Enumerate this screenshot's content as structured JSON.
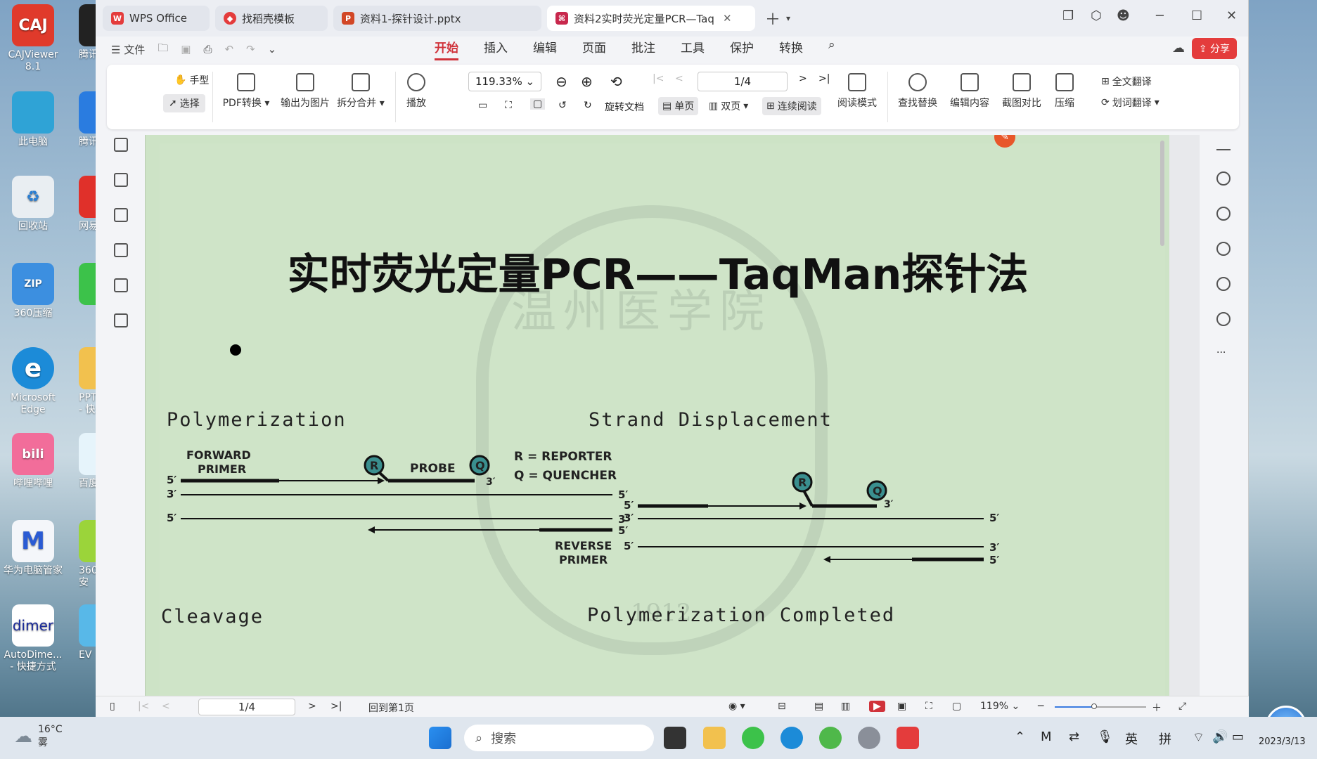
{
  "desktop": {
    "icons": [
      {
        "label": "CAJViewer 8.1",
        "color": "#e03a2b",
        "glyph": "CAJ"
      },
      {
        "label": "此电脑",
        "color": "#2fa3d6",
        "glyph": ""
      },
      {
        "label": "回收站",
        "color": "#e9eef2",
        "glyph": "♻"
      },
      {
        "label": "360压缩",
        "color": "#3c8fe0",
        "glyph": "ZIP"
      },
      {
        "label": "Microsoft Edge",
        "color": "#1c8bd8",
        "glyph": "e"
      },
      {
        "label": "哔哩哔哩",
        "color": "#f26d9a",
        "glyph": "bili"
      },
      {
        "label": "华为电脑管家",
        "color": "#f4f6fa",
        "glyph": "M"
      },
      {
        "label": "AutoDime... - 快捷方式",
        "color": "#ffffff",
        "glyph": "dimer"
      }
    ],
    "col2": [
      "腾讯",
      "腾讯",
      "网易",
      "",
      "PPT - 快",
      "百度",
      "360安",
      "EV"
    ]
  },
  "tabs": [
    {
      "label": "WPS Office",
      "icon": "wps-icon"
    },
    {
      "label": "找稻壳模板",
      "icon": "docer-icon"
    },
    {
      "label": "资料1-探针设计.pptx",
      "icon": "ppt-icon"
    },
    {
      "label": "资料2实时荧光定量PCR—Taq",
      "icon": "pdf-icon"
    }
  ],
  "menu": {
    "file": "文件",
    "items": [
      "开始",
      "插入",
      "编辑",
      "页面",
      "批注",
      "工具",
      "保护",
      "转换"
    ],
    "active": "开始",
    "share": "分享"
  },
  "ribbon": {
    "hand": "手型",
    "select": "选择",
    "pdf_convert": "PDF转换",
    "export_image": "输出为图片",
    "split_merge": "拆分合并",
    "play": "播放",
    "zoom": "119.33%",
    "page": "1/4",
    "rotate": "旋转文档",
    "single": "单页",
    "double": "双页",
    "continuous": "连续阅读",
    "read_mode": "阅读模式",
    "find_replace": "查找替换",
    "edit_content": "编辑内容",
    "screenshot_compare": "截图对比",
    "compress": "压缩",
    "full_translate": "全文翻译",
    "word_translate": "划词翻译"
  },
  "slide": {
    "title": "实时荧光定量PCR——TaqMan探针法",
    "watermark": "温州医学院",
    "watermark_year": "1912",
    "sections": {
      "polymerization": "Polymerization",
      "strand_displacement": "Strand Displacement",
      "cleavage": "Cleavage",
      "completed": "Polymerization Completed"
    },
    "figure": {
      "forward_primer_1": "FORWARD",
      "forward_primer_2": "PRIMER",
      "probe": "PROBE",
      "reporter_key": "R = REPORTER",
      "quencher_key": "Q = QUENCHER",
      "reverse_primer_1": "REVERSE",
      "reverse_primer_2": "PRIMER",
      "r": "R",
      "q": "Q",
      "five": "5′",
      "three": "3′"
    }
  },
  "status": {
    "page": "1/4",
    "back_first": "回到第1页",
    "zoom": "119%"
  },
  "taskbar": {
    "search": "搜索",
    "weather_temp": "16°C",
    "weather_desc": "雾",
    "ime1": "英",
    "ime2": "拼",
    "clock": "2023/3/13"
  }
}
